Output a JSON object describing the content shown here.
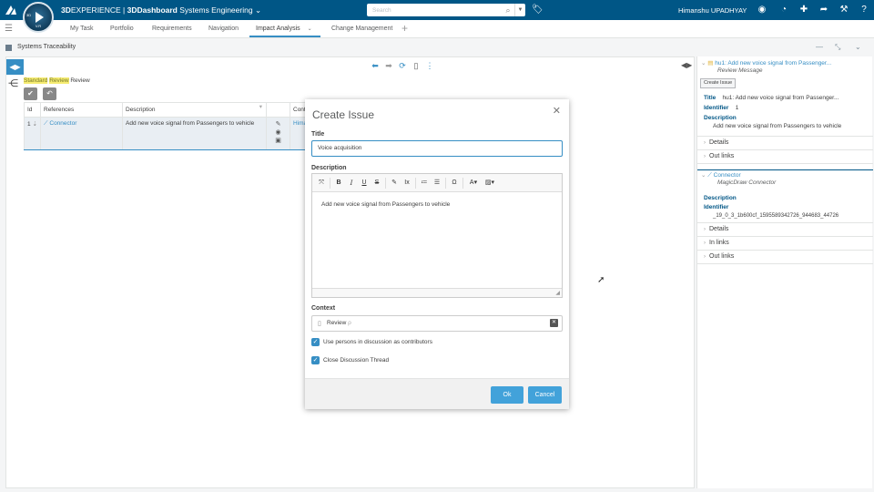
{
  "topbar": {
    "brand_prefix": "3D",
    "brand_experience": "EXPERIENCE | ",
    "brand_dashboard": "3DDashboard",
    "brand_context": " Systems Engineering",
    "search_placeholder": "Search",
    "username": "Himanshu UPADHYAY",
    "compass_version": "V.R"
  },
  "tabs": [
    {
      "label": "My Task"
    },
    {
      "label": "Portfolio"
    },
    {
      "label": "Requirements"
    },
    {
      "label": "Navigation"
    },
    {
      "label": "Impact Analysis"
    },
    {
      "label": "Change Management"
    }
  ],
  "widget": {
    "title": "Systems Traceability"
  },
  "review": {
    "highlight1": "Standard",
    "highlight2": "Review",
    "tail": " Review"
  },
  "grid": {
    "headers": {
      "id": "Id",
      "references": "References",
      "description": "Description",
      "context": "Cont"
    },
    "row": {
      "id": "1",
      "reference": "Connector",
      "description": "Add new voice signal from Passengers to vehicle",
      "context": "Hima"
    }
  },
  "dialog": {
    "title": "Create Issue",
    "title_label": "Title",
    "title_value": "Voice acquisition",
    "description_label": "Description",
    "description_value": "Add new voice signal from Passengers to vehicle",
    "context_label": "Context",
    "context_value": "Review",
    "checkbox1": "Use persons in discussion as contributors",
    "checkbox2": "Close Discussion Thread",
    "ok": "Ok",
    "cancel": "Cancel"
  },
  "right_panel": {
    "item1_title": "hu1: Add new voice signal from Passenger...",
    "item1_subtitle": "Review Message",
    "create_issue": "Create Issue",
    "title_key": "Title",
    "title_val": "hu1: Add new voice signal from Passenger...",
    "identifier_key": "Identifier",
    "identifier_val": "1",
    "description_key": "Description",
    "description_val": "Add new voice signal from Passengers to vehicle",
    "details": "Details",
    "out_links": "Out links",
    "item2_title": "Connector",
    "item2_subtitle": "MagicDraw Connector",
    "description2_key": "Description",
    "identifier2_key": "Identifier",
    "identifier2_val": "_19_0_3_1b600cf_1595589342726_944683_44726",
    "details2": "Details",
    "in_links2": "In links",
    "out_links2": "Out links"
  }
}
